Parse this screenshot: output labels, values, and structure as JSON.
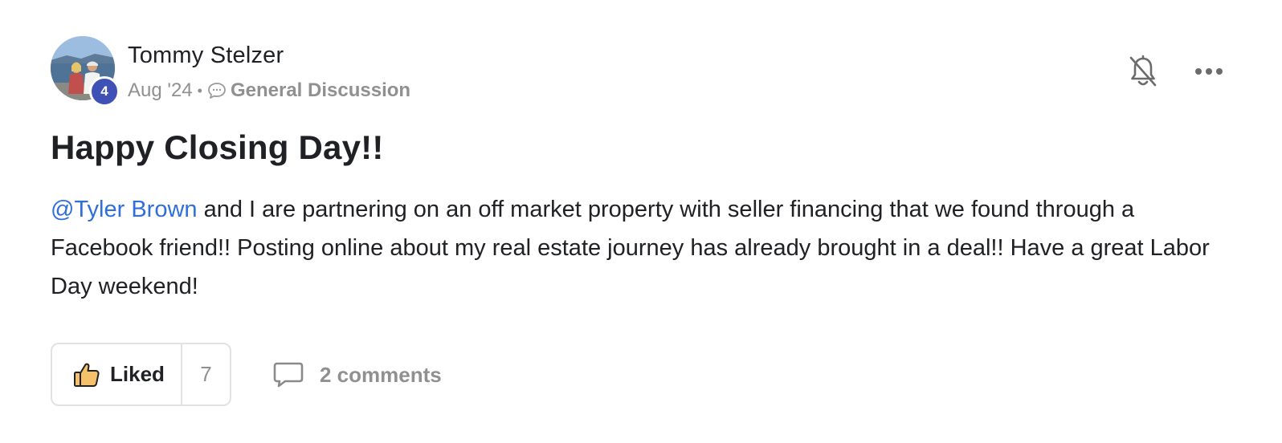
{
  "post": {
    "author_name": "Tommy Stelzer",
    "level": "4",
    "date": "Aug '24",
    "separator": "•",
    "category": "General Discussion",
    "title": "Happy Closing Day!!",
    "mention": "@Tyler Brown",
    "body_text": " and I are partnering on an off market property with seller financing that we found through a Facebook friend!! Posting online about my real estate journey has already brought in a deal!! Have a great Labor Day weekend!"
  },
  "actions": {
    "like_label": "Liked",
    "like_count": "7",
    "comments_label": "2 comments"
  },
  "icons": {
    "category": "speech-bubble-icon",
    "notifications": "bell-off-icon",
    "more": "more-options-icon",
    "like": "thumbs-up-icon",
    "comments": "comment-icon"
  },
  "colors": {
    "mention": "#2e6fd9",
    "level_badge": "#3f51b5",
    "muted_text": "#909090",
    "like_icon_fill": "#f5c26b"
  }
}
